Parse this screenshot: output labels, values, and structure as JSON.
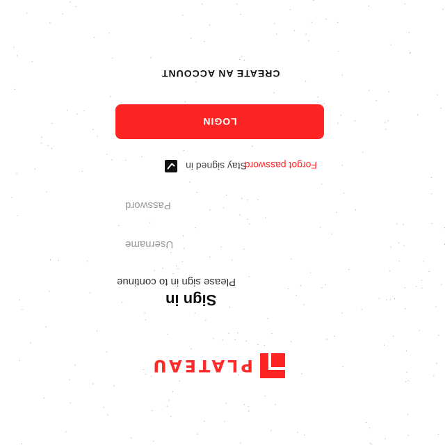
{
  "logo": {
    "text": "PLATEAU",
    "icon": "plateau-logo-mark"
  },
  "header": {
    "title": "Sign in",
    "subtitle": "Please sign in to continue"
  },
  "form": {
    "username_placeholder": "Username",
    "password_placeholder": "Password",
    "remember_label": "Stay signed in",
    "remember_checked": true,
    "forgot_label": "Forgot password",
    "login_label": "LOGIN",
    "create_account_label": "CREATE AN ACCOUNT"
  },
  "colors": {
    "accent": "#ff2424",
    "text": "#111111",
    "background": "#ffffff"
  }
}
